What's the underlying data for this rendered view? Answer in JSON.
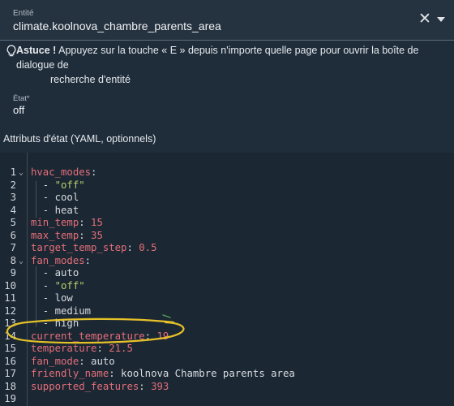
{
  "entity": {
    "label": "Entité",
    "value": "climate.koolnova_chambre_parents_area",
    "clear_icon": "close-icon",
    "dropdown_icon": "chevron-down-icon"
  },
  "tip": {
    "icon": "lightbulb-icon",
    "strong": "Astuce !",
    "text_line1": "Appuyez sur la touche « E » depuis n'importe quelle page pour ouvrir la boîte de dialogue de",
    "text_line2": "recherche d'entité"
  },
  "state": {
    "label": "État*",
    "value": "off"
  },
  "attributes_heading": "Attributs d'état (YAML, optionnels)",
  "editor": {
    "highlight_color": "#e6c229",
    "lines": [
      {
        "n": "1",
        "fold": true,
        "parts": [
          {
            "t": "hvac_modes",
            "c": "k"
          },
          {
            "t": ":",
            "c": "p"
          }
        ]
      },
      {
        "n": "2",
        "parts": [
          {
            "t": "  - ",
            "c": "p"
          },
          {
            "t": "\"off\"",
            "c": "s"
          }
        ]
      },
      {
        "n": "3",
        "parts": [
          {
            "t": "  - cool",
            "c": "p"
          }
        ]
      },
      {
        "n": "4",
        "parts": [
          {
            "t": "  - heat",
            "c": "p"
          }
        ]
      },
      {
        "n": "5",
        "parts": [
          {
            "t": "min_temp",
            "c": "k"
          },
          {
            "t": ": ",
            "c": "p"
          },
          {
            "t": "15",
            "c": "n"
          }
        ]
      },
      {
        "n": "6",
        "parts": [
          {
            "t": "max_temp",
            "c": "k"
          },
          {
            "t": ": ",
            "c": "p"
          },
          {
            "t": "35",
            "c": "n"
          }
        ]
      },
      {
        "n": "7",
        "parts": [
          {
            "t": "target_temp_step",
            "c": "k"
          },
          {
            "t": ": ",
            "c": "p"
          },
          {
            "t": "0.5",
            "c": "n"
          }
        ]
      },
      {
        "n": "8",
        "fold": true,
        "parts": [
          {
            "t": "fan_modes",
            "c": "k"
          },
          {
            "t": ":",
            "c": "p"
          }
        ]
      },
      {
        "n": "9",
        "parts": [
          {
            "t": "  - auto",
            "c": "p"
          }
        ]
      },
      {
        "n": "10",
        "parts": [
          {
            "t": "  - ",
            "c": "p"
          },
          {
            "t": "\"off\"",
            "c": "s"
          }
        ]
      },
      {
        "n": "11",
        "parts": [
          {
            "t": "  - low",
            "c": "p"
          }
        ]
      },
      {
        "n": "12",
        "parts": [
          {
            "t": "  - medium",
            "c": "p"
          }
        ]
      },
      {
        "n": "13",
        "parts": [
          {
            "t": "  - high",
            "c": "p"
          }
        ]
      },
      {
        "n": "14",
        "parts": [
          {
            "t": "current_temperature",
            "c": "k"
          },
          {
            "t": ": ",
            "c": "p"
          },
          {
            "t": "19",
            "c": "n"
          }
        ]
      },
      {
        "n": "15",
        "parts": [
          {
            "t": "temperature",
            "c": "k"
          },
          {
            "t": ": ",
            "c": "p"
          },
          {
            "t": "21.5",
            "c": "n"
          }
        ]
      },
      {
        "n": "16",
        "parts": [
          {
            "t": "fan_mode",
            "c": "k"
          },
          {
            "t": ": auto",
            "c": "p"
          }
        ]
      },
      {
        "n": "17",
        "parts": [
          {
            "t": "friendly_name",
            "c": "k"
          },
          {
            "t": ": koolnova Chambre parents area",
            "c": "p"
          }
        ]
      },
      {
        "n": "18",
        "parts": [
          {
            "t": "supported_features",
            "c": "k"
          },
          {
            "t": ": ",
            "c": "p"
          },
          {
            "t": "393",
            "c": "n"
          }
        ]
      },
      {
        "n": "19",
        "parts": []
      }
    ]
  }
}
